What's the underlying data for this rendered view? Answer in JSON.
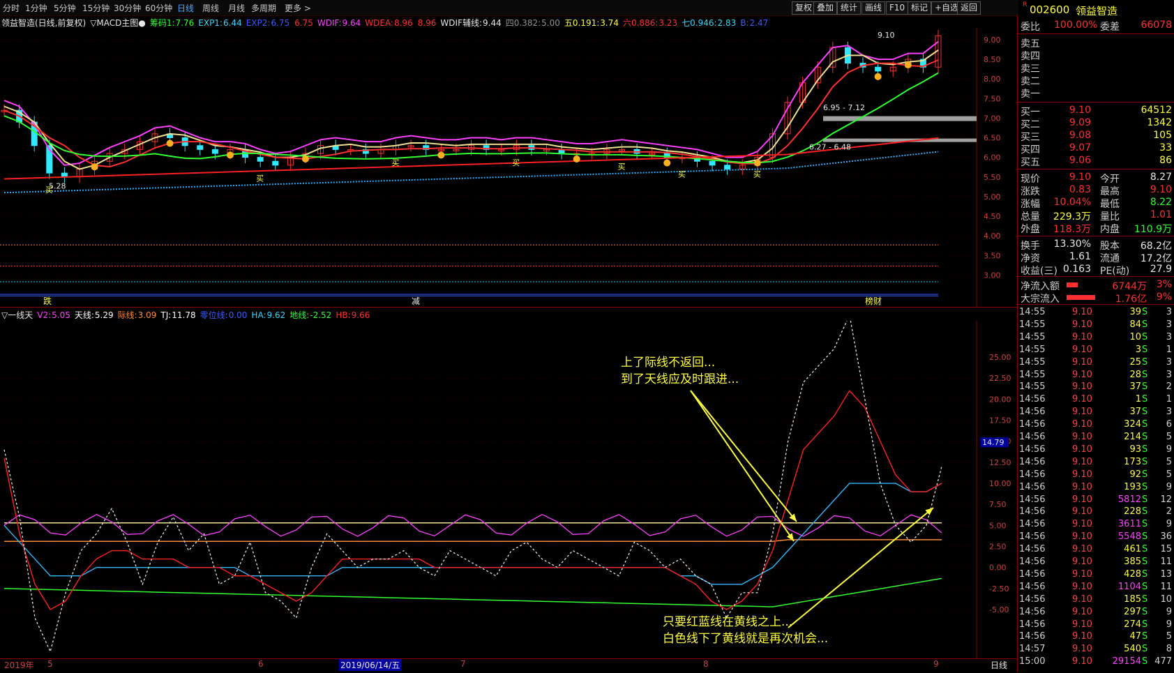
{
  "toolbar": {
    "periods": [
      "分时",
      "1分钟",
      "5分钟",
      "15分钟",
      "30分钟",
      "60分钟",
      "日线",
      "周线",
      "月线",
      "多周期",
      "更多 >"
    ],
    "active": "日线",
    "right_buttons": [
      "复权",
      "叠加",
      "统计",
      "画线",
      "F10",
      "标记",
      "+自选",
      "返回"
    ]
  },
  "stock": {
    "code": "002600",
    "name": "领益智造",
    "badge": "R"
  },
  "main_header": {
    "title": "领益智造(日线,前复权)",
    "indicator": "▽MACD主图●",
    "items": [
      {
        "label": "筹码1:",
        "value": "7.76",
        "color": "#30ff30"
      },
      {
        "label": "EXP1:",
        "value": "6.44",
        "color": "#30d8ff"
      },
      {
        "label": "EXP2:",
        "value": "6.75",
        "color": "#3a5cff"
      },
      {
        "label": "",
        "value": "6.75",
        "color": "#ff3030"
      },
      {
        "label": "WDIF:",
        "value": "9.64",
        "color": "#ff40ff"
      },
      {
        "label": "WDEA:",
        "value": "8.96",
        "color": "#ff3030"
      },
      {
        "label": "",
        "value": "8.96",
        "color": "#ff3030"
      },
      {
        "label": "WDIF辅线:",
        "value": "9.44",
        "color": "#e8e8e8"
      },
      {
        "label": "四0.382:",
        "value": "5.00",
        "color": "#909090"
      },
      {
        "label": "五0.191:",
        "value": "3.74",
        "color": "#ffff40"
      },
      {
        "label": "六0.886:",
        "value": "3.23",
        "color": "#ff3030"
      },
      {
        "label": "七0.946:",
        "value": "2.83",
        "color": "#30d8ff"
      },
      {
        "label": "B:",
        "value": "2.47",
        "color": "#3a5cff"
      }
    ]
  },
  "main_chart": {
    "y_ticks": [
      "9.00",
      "8.50",
      "8.00",
      "7.50",
      "7.00",
      "6.50",
      "6.00",
      "5.50",
      "5.00",
      "4.50",
      "4.00",
      "3.50",
      "3.00"
    ],
    "annotations": {
      "high": "9.10",
      "low": "5.28",
      "zone1": "6.95 - 7.12",
      "zone2": "6.27 - 6.48"
    },
    "markers": [
      "买",
      "买",
      "买",
      "买",
      "买",
      "买",
      "买"
    ],
    "bottom_labels": [
      {
        "text": "跌",
        "color": "#ffff40"
      },
      {
        "text": "减",
        "color": "#e8e8e8"
      },
      {
        "text": "榜财",
        "color": "#ffff40"
      }
    ]
  },
  "sub_header": {
    "title": "▽一线天",
    "items": [
      {
        "label": "V2:",
        "value": "5.05",
        "color": "#ff40ff"
      },
      {
        "label": "天线:",
        "value": "5.29",
        "color": "#ffffff"
      },
      {
        "label": "际线:",
        "value": "3.09",
        "color": "#ff8c30"
      },
      {
        "label": "TJ:",
        "value": "11.78",
        "color": "#ffffff"
      },
      {
        "label": "零位线:",
        "value": "0.00",
        "color": "#3a5cff"
      },
      {
        "label": "HA:",
        "value": "9.62",
        "color": "#30d8ff"
      },
      {
        "label": "地线:",
        "value": "-2.52",
        "color": "#30ff30"
      },
      {
        "label": "HB:",
        "value": "9.66",
        "color": "#ff3030"
      }
    ]
  },
  "sub_chart": {
    "y_ticks": [
      "25.00",
      "22.50",
      "20.00",
      "17.50",
      "15.00",
      "12.50",
      "10.00",
      "7.50",
      "5.00",
      "2.50",
      "0.00",
      "-2.50",
      "-5.00"
    ],
    "cursor_value": "14.79",
    "note1": [
      "上了际线不返回...",
      "到了天线应及时跟进..."
    ],
    "note2": [
      "只要红蓝线在黄线之上...",
      "白色线下了黄线就是再次机会..."
    ]
  },
  "dates": {
    "year": "2019年",
    "months": [
      "5",
      "6",
      "7",
      "8",
      "9"
    ],
    "cursor_date": "2019/06/14/五",
    "period_btn": "日线"
  },
  "orderbook": {
    "weibi_label": "委比",
    "weibi": "100.00%",
    "weicha_label": "委差",
    "weicha": "66078",
    "asks": [
      {
        "label": "卖五"
      },
      {
        "label": "卖四"
      },
      {
        "label": "卖三"
      },
      {
        "label": "卖二"
      },
      {
        "label": "卖一"
      }
    ],
    "bids": [
      {
        "label": "买一",
        "price": "9.10",
        "vol": "64512"
      },
      {
        "label": "买二",
        "price": "9.09",
        "vol": "1342"
      },
      {
        "label": "买三",
        "price": "9.08",
        "vol": "105"
      },
      {
        "label": "买四",
        "price": "9.07",
        "vol": "33"
      },
      {
        "label": "买五",
        "price": "9.06",
        "vol": "86"
      }
    ]
  },
  "quote": {
    "rows": [
      {
        "l1": "现价",
        "v1": "9.10",
        "c1": "#ff3030",
        "l2": "今开",
        "v2": "8.27",
        "c2": "#e8e8e8"
      },
      {
        "l1": "涨跌",
        "v1": "0.83",
        "c1": "#ff3030",
        "l2": "最高",
        "v2": "9.10",
        "c2": "#ff3030"
      },
      {
        "l1": "涨幅",
        "v1": "10.04%",
        "c1": "#ff3030",
        "l2": "最低",
        "v2": "8.22",
        "c2": "#30ff30"
      },
      {
        "l1": "总量",
        "v1": "229.3万",
        "c1": "#ffff40",
        "l2": "量比",
        "v2": "1.01",
        "c2": "#ff3030"
      },
      {
        "l1": "外盘",
        "v1": "118.3万",
        "c1": "#ff3030",
        "l2": "内盘",
        "v2": "110.9万",
        "c2": "#30ff30"
      }
    ],
    "rows2": [
      {
        "l1": "换手",
        "v1": "13.30%",
        "l2": "股本",
        "v2": "68.2亿"
      },
      {
        "l1": "净资",
        "v1": "1.61",
        "l2": "流通",
        "v2": "17.2亿"
      },
      {
        "l1": "收益(三)",
        "v1": "0.163",
        "l2": "PE(动)",
        "v2": "27.9"
      }
    ],
    "flows": [
      {
        "label": "净流入额",
        "value": "6744万",
        "pct": "3%",
        "bar": 0.35
      },
      {
        "label": "大宗流入",
        "value": "1.76亿",
        "pct": "9%",
        "bar": 0.9
      }
    ]
  },
  "ticks": [
    {
      "t": "14:55",
      "p": "9.10",
      "v": "39",
      "n": "3"
    },
    {
      "t": "14:55",
      "p": "9.10",
      "v": "84",
      "n": "3"
    },
    {
      "t": "14:55",
      "p": "9.10",
      "v": "10",
      "n": "3"
    },
    {
      "t": "14:55",
      "p": "9.10",
      "v": "3",
      "n": "1"
    },
    {
      "t": "14:55",
      "p": "9.10",
      "v": "25",
      "n": "3"
    },
    {
      "t": "14:55",
      "p": "9.10",
      "v": "28",
      "n": "3"
    },
    {
      "t": "14:55",
      "p": "9.10",
      "v": "37",
      "n": "2"
    },
    {
      "t": "14:56",
      "p": "9.10",
      "v": "1",
      "n": "1"
    },
    {
      "t": "14:56",
      "p": "9.10",
      "v": "37",
      "n": "3"
    },
    {
      "t": "14:56",
      "p": "9.10",
      "v": "324",
      "n": "6"
    },
    {
      "t": "14:56",
      "p": "9.10",
      "v": "214",
      "n": "5"
    },
    {
      "t": "14:56",
      "p": "9.10",
      "v": "93",
      "n": "9"
    },
    {
      "t": "14:56",
      "p": "9.10",
      "v": "173",
      "n": "5"
    },
    {
      "t": "14:56",
      "p": "9.10",
      "v": "92",
      "n": "5"
    },
    {
      "t": "14:56",
      "p": "9.10",
      "v": "193",
      "n": "9"
    },
    {
      "t": "14:56",
      "p": "9.10",
      "v": "5812",
      "n": "12",
      "big": true
    },
    {
      "t": "14:56",
      "p": "9.10",
      "v": "228",
      "n": "2"
    },
    {
      "t": "14:56",
      "p": "9.10",
      "v": "3611",
      "n": "9",
      "big": true
    },
    {
      "t": "14:56",
      "p": "9.10",
      "v": "5548",
      "n": "36",
      "big": true
    },
    {
      "t": "14:56",
      "p": "9.10",
      "v": "461",
      "n": "15"
    },
    {
      "t": "14:56",
      "p": "9.10",
      "v": "385",
      "n": "11"
    },
    {
      "t": "14:56",
      "p": "9.10",
      "v": "428",
      "n": "13"
    },
    {
      "t": "14:56",
      "p": "9.10",
      "v": "1104",
      "n": "11",
      "big": true
    },
    {
      "t": "14:56",
      "p": "9.10",
      "v": "185",
      "n": "10"
    },
    {
      "t": "14:56",
      "p": "9.10",
      "v": "297",
      "n": "9"
    },
    {
      "t": "14:56",
      "p": "9.10",
      "v": "274",
      "n": "9"
    },
    {
      "t": "14:56",
      "p": "9.10",
      "v": "47",
      "n": "5"
    },
    {
      "t": "14:57",
      "p": "9.10",
      "v": "540",
      "n": "8"
    },
    {
      "t": "15:00",
      "p": "9.10",
      "v": "29154",
      "n": "477",
      "big": true
    }
  ],
  "tick_bs": "S",
  "chart_data": {
    "type": "line",
    "candles_close": [
      7.2,
      6.9,
      6.3,
      5.6,
      5.5,
      5.7,
      5.9,
      6.1,
      6.2,
      6.4,
      6.6,
      6.5,
      6.3,
      6.2,
      6.1,
      6.2,
      6.0,
      5.9,
      5.8,
      6.0,
      6.1,
      6.3,
      6.2,
      6.2,
      6.1,
      6.2,
      6.3,
      6.3,
      6.2,
      6.2,
      6.2,
      6.3,
      6.2,
      6.2,
      6.3,
      6.2,
      6.2,
      6.1,
      6.1,
      6.1,
      6.2,
      6.2,
      6.1,
      6.1,
      6.0,
      6.0,
      5.9,
      5.8,
      5.7,
      5.8,
      6.0,
      6.6,
      7.4,
      7.9,
      8.3,
      8.8,
      8.4,
      8.3,
      8.2,
      8.3,
      8.5,
      8.3,
      9.1
    ],
    "sub_series": {
      "white": [
        14,
        6,
        -6,
        -10,
        -3,
        2,
        4,
        7,
        3,
        -2,
        3,
        6,
        2,
        4,
        -2,
        -1,
        3,
        -3,
        -4,
        -6,
        0,
        4,
        2,
        0,
        1,
        1,
        2,
        0,
        -1,
        2,
        1,
        0,
        -1,
        2,
        3,
        1,
        0,
        2,
        1,
        0,
        -1,
        3,
        2,
        0,
        1,
        -1,
        -2,
        -6,
        -3,
        -3,
        4,
        15,
        22,
        24,
        26,
        30,
        20,
        10,
        5,
        3,
        5,
        12
      ],
      "red": [
        13,
        4,
        -2,
        -5,
        -4,
        -1,
        1,
        2,
        2,
        1,
        1,
        1,
        0,
        0,
        0,
        -1,
        -1,
        -2,
        -3,
        -4,
        -3,
        -1,
        1,
        1,
        1,
        1,
        1,
        1,
        0,
        0,
        0,
        0,
        0,
        0,
        0,
        0,
        0,
        0,
        0,
        0,
        0,
        0,
        0,
        0,
        -1,
        -2,
        -4,
        -5,
        -4,
        -2,
        2,
        8,
        14,
        16,
        18,
        21,
        19,
        15,
        11,
        9,
        9,
        10
      ],
      "blue": [
        5,
        3,
        1,
        -1,
        -1,
        -1,
        0,
        0,
        0,
        0,
        0,
        0,
        0,
        0,
        0,
        0,
        -1,
        -1,
        -1,
        -1,
        -1,
        -1,
        0,
        0,
        0,
        0,
        0,
        0,
        0,
        0,
        0,
        0,
        0,
        0,
        0,
        0,
        0,
        0,
        0,
        0,
        0,
        0,
        0,
        0,
        -1,
        -1,
        -2,
        -2,
        -2,
        -1,
        0,
        2,
        4,
        6,
        8,
        10,
        10,
        10,
        10,
        9,
        9,
        10
      ]
    }
  }
}
